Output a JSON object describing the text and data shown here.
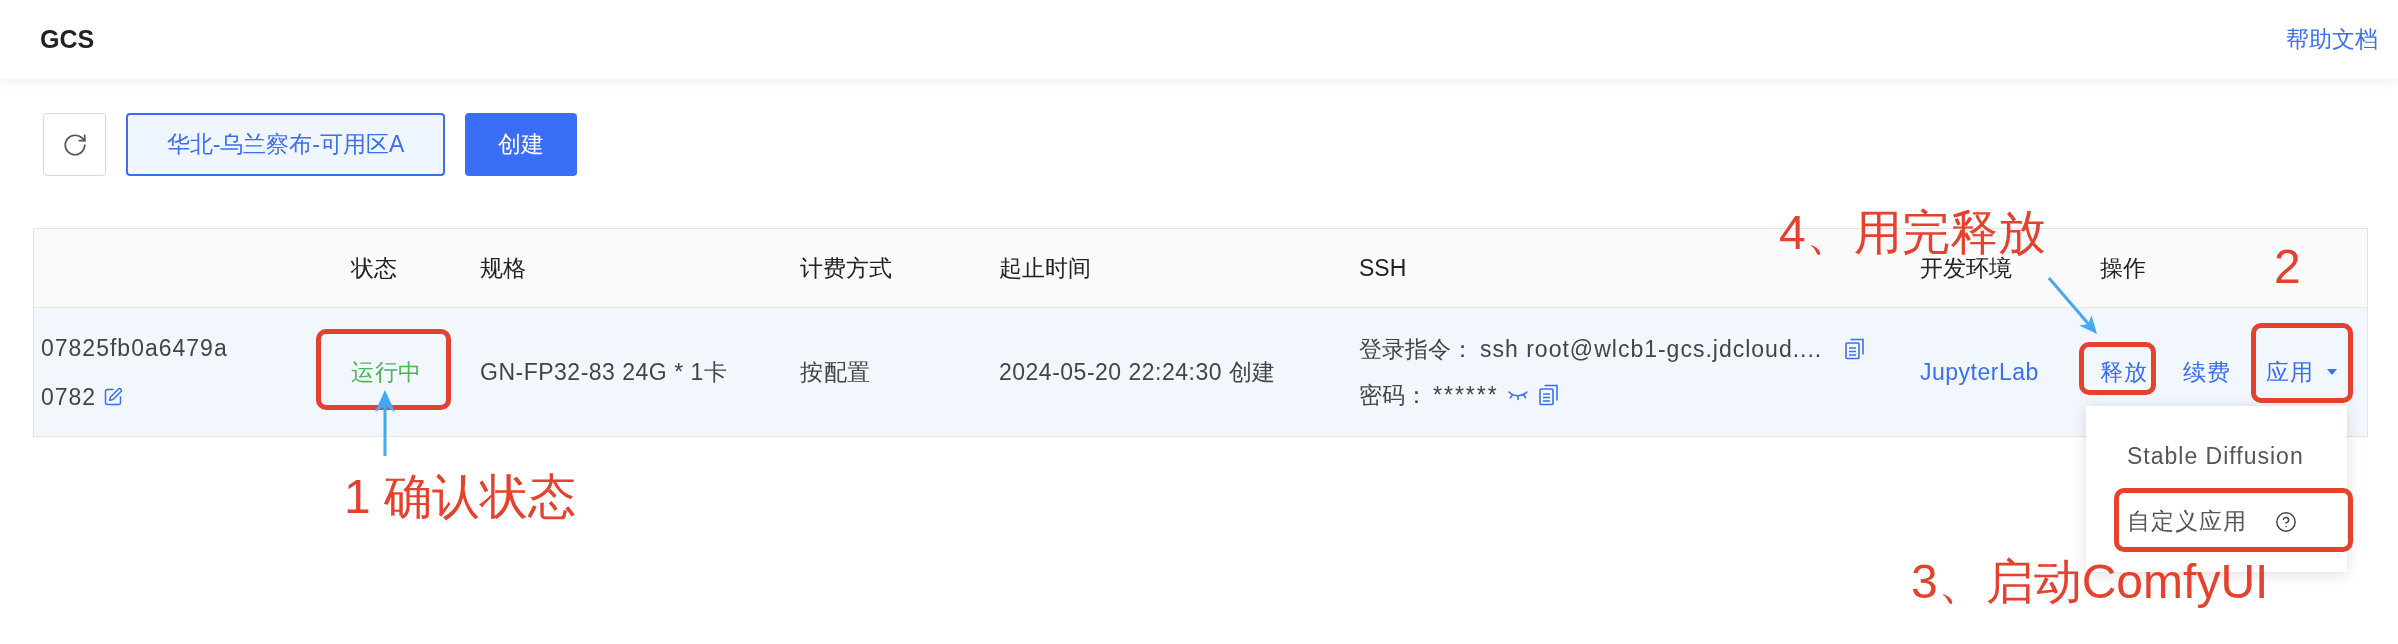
{
  "header": {
    "title": "GCS",
    "help_link": "帮助文档"
  },
  "toolbar": {
    "region": "华北-乌兰察布-可用区A",
    "create": "创建"
  },
  "table": {
    "columns": [
      "状态",
      "规格",
      "计费方式",
      "起止时间",
      "SSH",
      "开发环境",
      "操作"
    ],
    "rows": [
      {
        "hovered": true,
        "id": "07825fb0a6479a",
        "name": "0782",
        "status": {
          "label": "运行中",
          "kind": "running",
          "boxed": true,
          "annotation": {
            "text": "1 确认状态",
            "arrow": true
          }
        },
        "spec": "GN-FP32-83 24G * 1卡",
        "billing": "按配置",
        "time": "2024-05-20 22:24:30 创建",
        "ssh": {
          "command_label": "登录指令：",
          "command": "ssh root@wlcb1-gcs.jdcloud....",
          "password_label": "密码：",
          "password": "******",
          "password_visible": false
        },
        "dev_env": "JupyterLab",
        "actions": [
          {
            "kind": "link",
            "label": "释放",
            "boxed": true,
            "annotation": {
              "text": "4、用完释放",
              "arrow": true
            }
          },
          {
            "kind": "link",
            "label": "续费",
            "boxed": false
          },
          {
            "kind": "dropdown",
            "label": "应用",
            "boxed": true,
            "expanded": true,
            "annotation": {
              "text": "2",
              "arrow": false
            },
            "menu": [
              {
                "label": "Stable Diffusion",
                "help": false,
                "boxed": false
              },
              {
                "label": "自定义应用",
                "help": true,
                "boxed": true,
                "annotation": {
                  "text": "3、启动ComfyUI",
                  "arrow": false
                }
              }
            ]
          }
        ]
      }
    ]
  }
}
